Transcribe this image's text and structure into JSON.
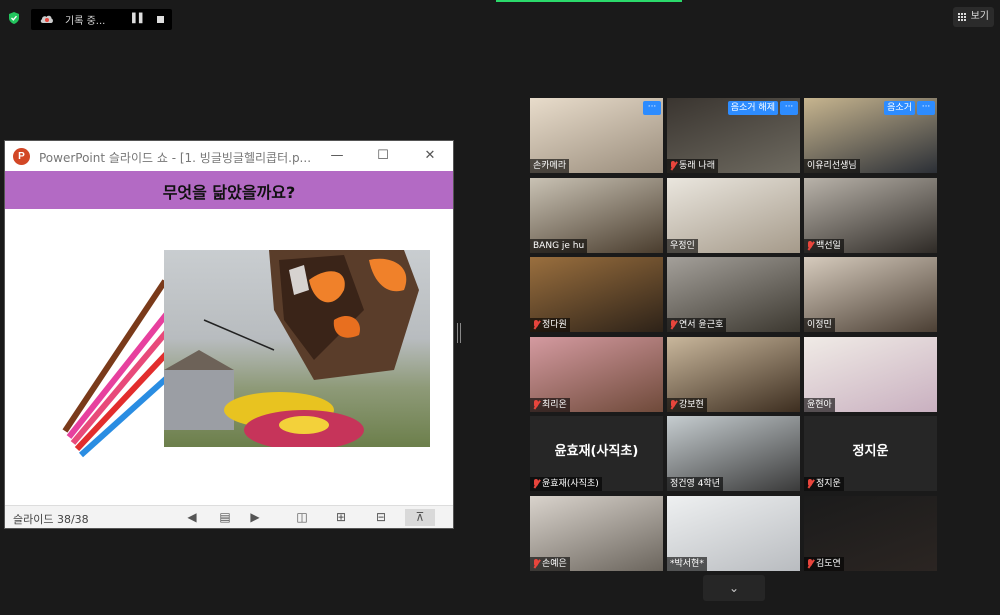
{
  "recording": {
    "label": "기록 중...",
    "pause_icon": "pause-icon",
    "stop_icon": "stop-icon"
  },
  "toolbar": {
    "view_label": "보기"
  },
  "ppt": {
    "title": "PowerPoint 슬라이드 쇼 - [1. 빙글빙글헬리콥터.p...",
    "slide_heading": "무엇을 닮았을까요?",
    "slide_counter": "슬라이드 38/38",
    "brand_color": "#b36ac4"
  },
  "gallery": {
    "tiles": [
      {
        "name": "손카메라",
        "muted": false,
        "more": true
      },
      {
        "name": "동래 나래",
        "muted": true,
        "more": true,
        "unmute": "음소거 해제"
      },
      {
        "name": "이유리선생님",
        "muted": false,
        "more": true,
        "unmute": "음소거"
      },
      {
        "name": "BANG je hu",
        "muted": false
      },
      {
        "name": "우정인",
        "muted": false
      },
      {
        "name": "백선일",
        "muted": true
      },
      {
        "name": "정다원",
        "muted": true
      },
      {
        "name": "연서 윤근호",
        "muted": true
      },
      {
        "name": "이정민",
        "muted": false
      },
      {
        "name": "최리온",
        "muted": true
      },
      {
        "name": "강보현",
        "muted": true
      },
      {
        "name": "윤현아",
        "muted": false,
        "active": true
      },
      {
        "name": "윤효재(사직초)",
        "muted": true,
        "big": "윤효재(사직초)"
      },
      {
        "name": "정건영 4학년",
        "muted": false
      },
      {
        "name": "정지운",
        "muted": true,
        "big": "정지운"
      },
      {
        "name": "손예은",
        "muted": true
      },
      {
        "name": "*박서현*",
        "muted": false
      },
      {
        "name": "김도연",
        "muted": true
      }
    ]
  }
}
